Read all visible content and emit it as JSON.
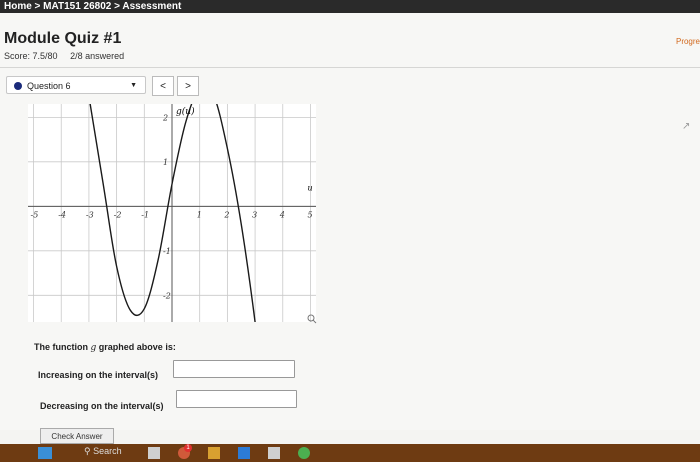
{
  "breadcrumb": "Home > MAT151 26802 > Assessment",
  "quiz": {
    "title": "Module Quiz #1",
    "score": "Score: 7.5/80",
    "answered": "2/8 answered",
    "progress_label": "Progre"
  },
  "question_selector": {
    "value": "Question 6"
  },
  "nav": {
    "prev": "<",
    "next": ">"
  },
  "graph": {
    "function_label": "g(u)",
    "axis_variable": "u",
    "x_ticks": [
      "-5",
      "-4",
      "-3",
      "-2",
      "-1",
      "1",
      "2",
      "3",
      "4",
      "5"
    ],
    "y_ticks": [
      "2",
      "1",
      "-1",
      "-2"
    ]
  },
  "chart_data": {
    "type": "line",
    "series": [
      {
        "values": [
          [
            -3.4,
            4.0
          ],
          [
            -2.5,
            0.56
          ],
          [
            -2.0,
            -1.35
          ],
          [
            -1.5,
            -2.34
          ],
          [
            -1.0,
            -2.3
          ],
          [
            -0.5,
            -1.2
          ],
          [
            0.0,
            0.5
          ],
          [
            0.5,
            1.9
          ],
          [
            1.0,
            2.65
          ],
          [
            1.5,
            2.5
          ],
          [
            2.0,
            1.3
          ],
          [
            2.5,
            -0.4
          ],
          [
            3.0,
            -2.6
          ],
          [
            3.2,
            -3.8
          ]
        ]
      }
    ],
    "xlim": [
      -5.2,
      5.2
    ],
    "ylim": [
      -2.6,
      2.3
    ],
    "grid": true
  },
  "form": {
    "prompt_prefix": "The function",
    "prompt_var": "g",
    "prompt_suffix": "graphed above is:",
    "increasing_label": "Increasing on the interval(s)",
    "decreasing_label": "Decreasing on the interval(s)",
    "increasing_value": "",
    "decreasing_value": ""
  },
  "check_button": "Check Answer",
  "taskbar": {
    "search_label": "Search",
    "badge": "1"
  }
}
